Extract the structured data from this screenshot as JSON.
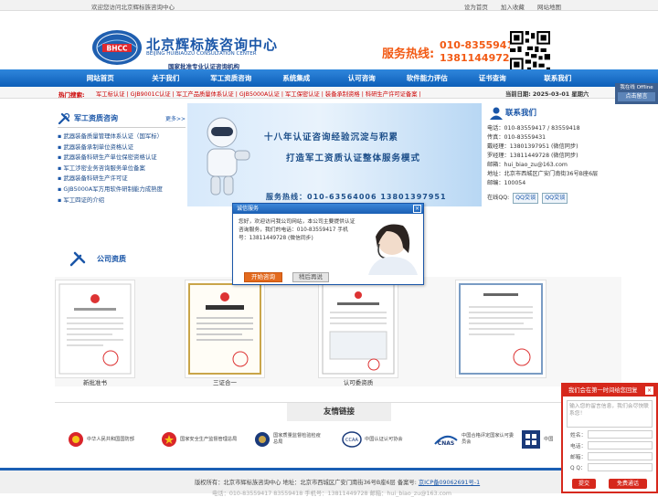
{
  "topbar": {
    "welcome": "欢迎您访问北京辉标族咨询中心",
    "links": [
      "设为首页",
      "加入收藏",
      "网站地图"
    ]
  },
  "header": {
    "name": "北京辉标族咨询中心",
    "english": "BEIJING HUIBIAOZU CONSULTATION CENTER",
    "slogan": "国家批准专业认证咨询机构",
    "logo_text": "BHCC",
    "hotline_label": "服务热线:",
    "phone1": "010-83559418",
    "phone2": "13811449728"
  },
  "nav": [
    "网站首页",
    "关于我们",
    "军工资质咨询",
    "系统集成",
    "认可咨询",
    "软件能力评估",
    "证书查询",
    "联系我们"
  ],
  "hotbar": {
    "label": "热门搜索:",
    "keywords": "军工标认证 | GJB9001C认证 | 军工产品质量体系认证 | GJB5000A认证 | 军工保密认证 | 装备承制资格 | 科研生产许可证备案 |",
    "date": "当前日期:  2025-03-01 星期六"
  },
  "sidebar": {
    "title": "军工资质咨询",
    "more": "更多>>",
    "items": [
      "武器装备质量管理体系认证（国军标）",
      "武器装备承制单位资格认证",
      "武器装备科研生产单位保密资格认证",
      "军工涉密业务咨询服务单位备案",
      "武器装备科研生产许可证",
      "GJB5000A军方用软件研制能力成熟度",
      "军工四证的介绍"
    ]
  },
  "banner": {
    "line1": "十八年认证咨询经验沉淀与积累",
    "line2": "打造军工资质认证整体服务模式",
    "line3": "服务热线：010-63564006  13801397951"
  },
  "contact": {
    "title": "联系我们",
    "rows": [
      "电话：010-83559417 / 83559418",
      "传真：010-83559431",
      "戴经理：13801397951  (微信同步)",
      "罗经理：13811449728  (微信同步)",
      "邮箱：hui_biao_zu@163.com",
      "地址：北京市西城区广安门南街36号B座6层",
      "邮编：100054"
    ],
    "online_label": "在线QQ:",
    "qq_buttons": [
      "QQ交谈",
      "QQ交谈"
    ]
  },
  "certs": {
    "title": "公司资质",
    "items": [
      "新批准书",
      "三证合一",
      "认可委资质",
      ""
    ]
  },
  "links": {
    "title": "友情链接",
    "items": [
      "中华人民共和国国防部",
      "国家安全生产监督管理总局",
      "国家质量监督检验检疫总局",
      "中国认证认可协会",
      "中国合格评定国家认可委员会",
      "中国"
    ]
  },
  "footer": {
    "line1_prefix": "版权所有：北京市辉标族咨询中心    地址：北京市西城区广安门南街36号B座6层    备案号: ",
    "icp": "京ICP备09062691号-1",
    "line2": "电话：010-83559417 83559418 手机号：13811449728  邮箱：hui_biao_zu@163.com"
  },
  "modal": {
    "title": "诚信服务",
    "text": "您好，欢迎访问我公司网站，本公司主要提供认证咨询服务，我们的电话：010-83559417  手机号：13811449728  (微信同步)",
    "accept": "开始咨询",
    "later": "稍后再说"
  },
  "chat_widget": {
    "line1": "我在线 Offline",
    "button": "点击留言"
  },
  "message_widget": {
    "title": "我们会在第一时间给您回复",
    "textarea_placeholder": "输入您的留言信息，我们会尽快联系您！",
    "fields": [
      "姓名：",
      "电话：",
      "邮箱：",
      "Q Q："
    ],
    "submit": "提交",
    "free_call": "免费通话"
  }
}
